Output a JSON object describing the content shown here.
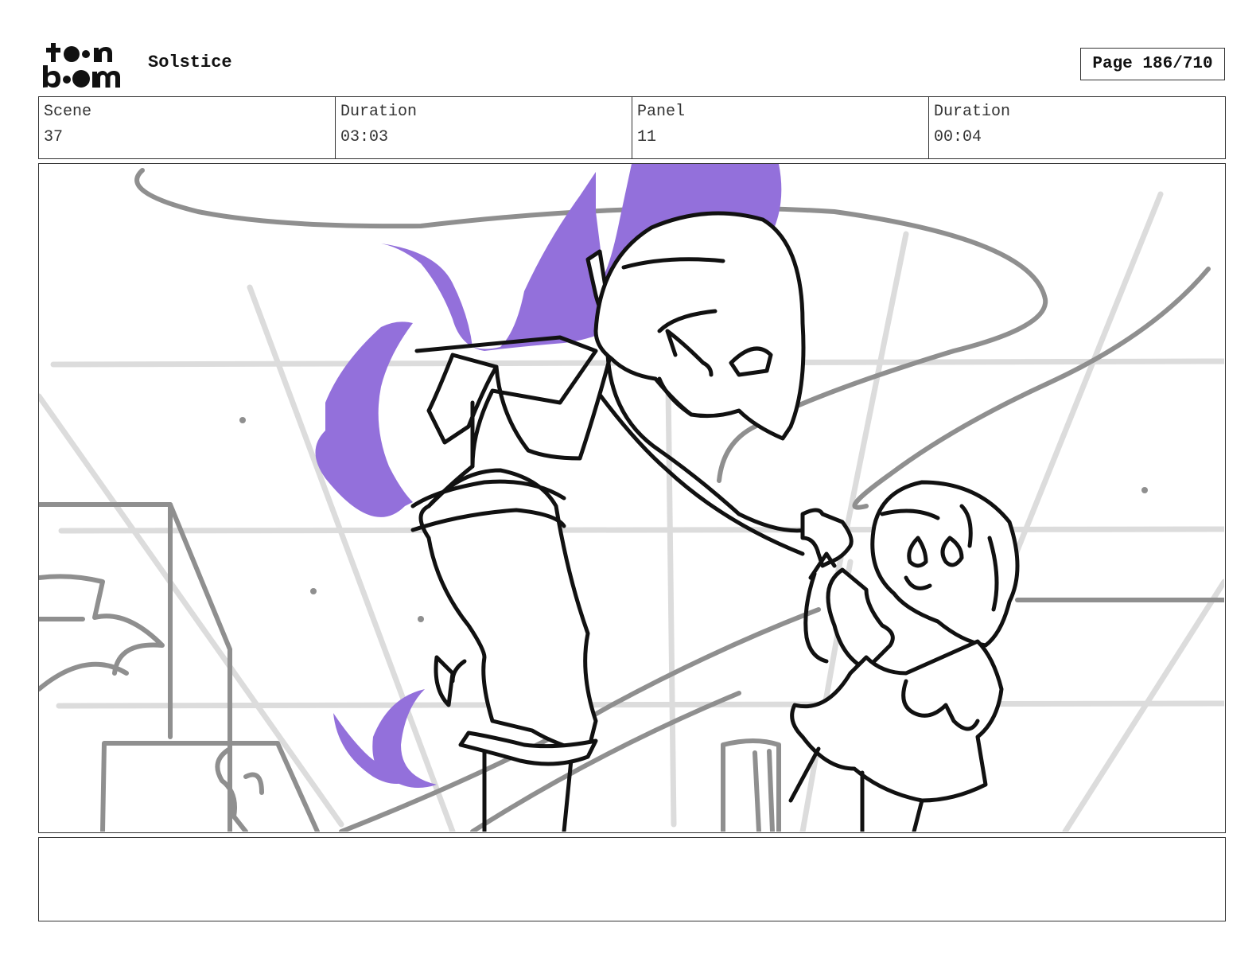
{
  "header": {
    "logo_text": "toon boom",
    "project_title": "Solstice",
    "page_label": "Page 186/710"
  },
  "info": {
    "scene_label": "Scene",
    "scene_value": "37",
    "scene_duration_label": "Duration",
    "scene_duration_value": "03:03",
    "panel_label": "Panel",
    "panel_value": "11",
    "panel_duration_label": "Duration",
    "panel_duration_value": "00:04"
  },
  "panel": {
    "flame_color": "#9370DB",
    "line_color": "#111111",
    "background_line_color": "#8f8f8f",
    "light_line_color": "#dcdcdc"
  },
  "notes": {
    "text": ""
  }
}
